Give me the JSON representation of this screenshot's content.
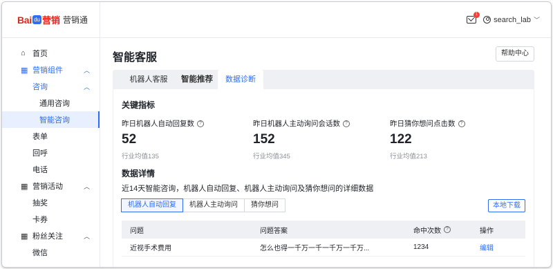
{
  "brand": {
    "bai": "Bai",
    "paw": "du",
    "red": "营销",
    "sub": "营销通"
  },
  "sidebar": {
    "items": [
      {
        "label": "首页",
        "icon": "home-icon"
      },
      {
        "label": "营销组件",
        "icon": "grid-icon"
      },
      {
        "label": "咨询"
      },
      {
        "label": "通用咨询"
      },
      {
        "label": "智能咨询"
      },
      {
        "label": "表单"
      },
      {
        "label": "回呼"
      },
      {
        "label": "电话"
      },
      {
        "label": "营销活动",
        "icon": "grid-icon"
      },
      {
        "label": "抽奖"
      },
      {
        "label": "卡券"
      },
      {
        "label": "粉丝关注",
        "icon": "grid-icon"
      },
      {
        "label": "微信"
      }
    ]
  },
  "topbar": {
    "badge": "1",
    "username": "search_lab"
  },
  "page": {
    "title": "智能客服",
    "help_button": "帮助中心",
    "tabs": [
      "机器人客服",
      "智能推荐",
      "数据诊断"
    ]
  },
  "metrics_section": {
    "title": "关键指标",
    "items": [
      {
        "label": "昨日机器人自动回复数",
        "value": "52",
        "avg": "行业均值135"
      },
      {
        "label": "昨日机器人主动询问会话数",
        "value": "152",
        "avg": "行业均值345"
      },
      {
        "label": "昨日猜你想问点击数",
        "value": "122",
        "avg": "行业均值213"
      }
    ]
  },
  "details_section": {
    "title": "数据详情",
    "description": "近14天智能咨询，机器人自动回复、机器人主动询问及猜你想问的详细数据",
    "subtabs": [
      "机器人自动回复",
      "机器人主动询问",
      "猜你想问"
    ],
    "download_button": "本地下载",
    "table": {
      "headers": [
        "问题",
        "问题答案",
        "命中次数",
        "操作"
      ],
      "rows": [
        {
          "question": "近视手术费用",
          "answer": "怎么也得一千万一千一千万一千万...",
          "hits": "1234",
          "action": "编辑"
        }
      ]
    }
  },
  "colors": {
    "accent": "#2f6df6",
    "brand_red": "#e1251b"
  }
}
